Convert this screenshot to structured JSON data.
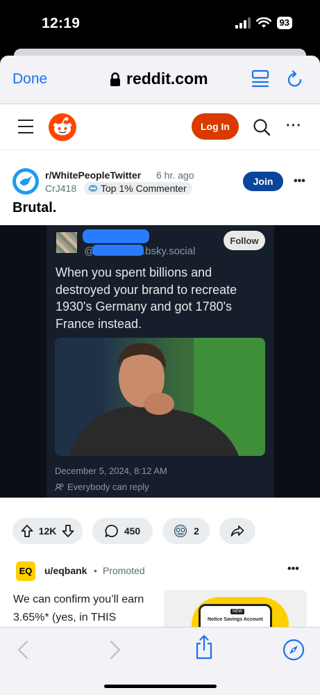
{
  "status": {
    "time": "12:19",
    "battery": "93"
  },
  "browser": {
    "done_label": "Done",
    "url": "reddit.com",
    "accent": "#1a73e8"
  },
  "reddit_header": {
    "login_label": "Log In",
    "brand_color": "#d93a00"
  },
  "post": {
    "subreddit": "r/WhitePeopleTwitter",
    "time_ago": "6 hr. ago",
    "author": "CrJ418",
    "flair": "Top 1% Commenter",
    "join_label": "Join",
    "title": "Brutal.",
    "tweet": {
      "handle_at": "@",
      "handle_domain": ".bsky.social",
      "follow_label": "Follow",
      "text": "When you spent billions and destroyed your brand to recreate 1930's Germany and got 1780's France instead.",
      "date": "December 5, 2024, 8:12 AM",
      "reply_setting": "Everybody can reply"
    },
    "actions": {
      "votes": "12K",
      "comments": "450",
      "awards": "2"
    }
  },
  "promo": {
    "logo_text": "EQ",
    "user": "u/eqbank",
    "separator": "•",
    "label": "Promoted",
    "text": "We can confirm you’ll earn 3.65%* (yes, in THIS",
    "image_badge": "NEW",
    "image_caption": "Notice Savings Account"
  }
}
